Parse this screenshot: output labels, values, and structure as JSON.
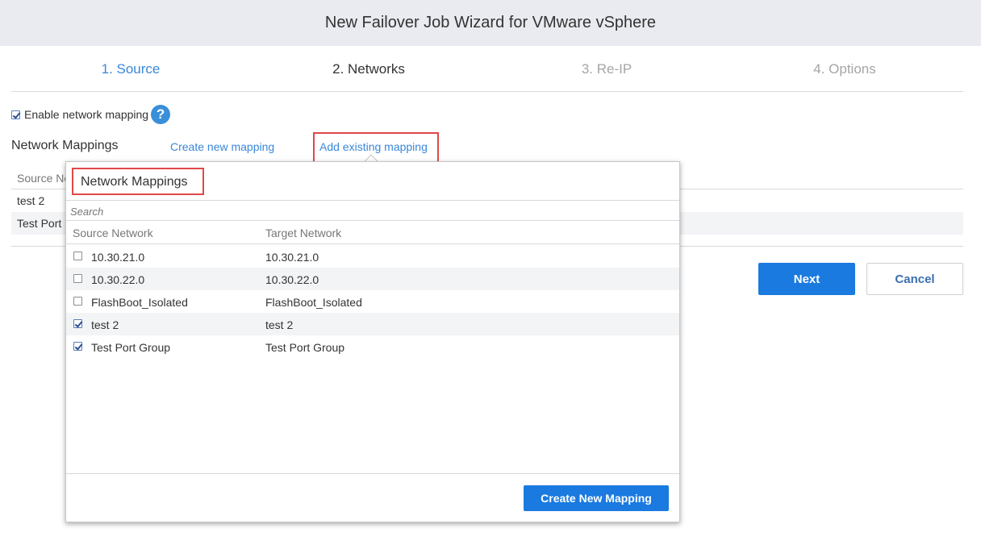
{
  "window": {
    "title": "New Failover Job Wizard for VMware vSphere"
  },
  "steps": [
    {
      "label": "1. Source",
      "state": "done"
    },
    {
      "label": "2. Networks",
      "state": "active"
    },
    {
      "label": "3. Re-IP",
      "state": "todo"
    },
    {
      "label": "4. Options",
      "state": "todo"
    }
  ],
  "network": {
    "enable_label": "Enable network mapping",
    "enable_checked": true,
    "help_glyph": "?",
    "help_icon": "question-circle-icon",
    "section_title": "Network Mappings",
    "create_link": "Create new mapping",
    "existing_link": "Add existing mapping",
    "table_header_partial": "Source Ne",
    "rows": [
      "test 2",
      "Test Port"
    ]
  },
  "actions": {
    "next": "Next",
    "cancel": "Cancel"
  },
  "popup": {
    "title": "Network Mappings",
    "search_placeholder": "Search",
    "col_source": "Source Network",
    "col_target": "Target Network",
    "rows": [
      {
        "source": "10.30.21.0",
        "target": "10.30.21.0",
        "checked": false
      },
      {
        "source": "10.30.22.0",
        "target": "10.30.22.0",
        "checked": false
      },
      {
        "source": "FlashBoot_Isolated",
        "target": "FlashBoot_Isolated",
        "checked": false
      },
      {
        "source": "test 2",
        "target": "test 2",
        "checked": true
      },
      {
        "source": "Test Port Group",
        "target": "Test Port Group",
        "checked": true
      }
    ],
    "create_button": "Create New Mapping"
  },
  "colors": {
    "accent": "#1a7ae0",
    "link": "#3a87d9",
    "highlight": "#e04848"
  }
}
